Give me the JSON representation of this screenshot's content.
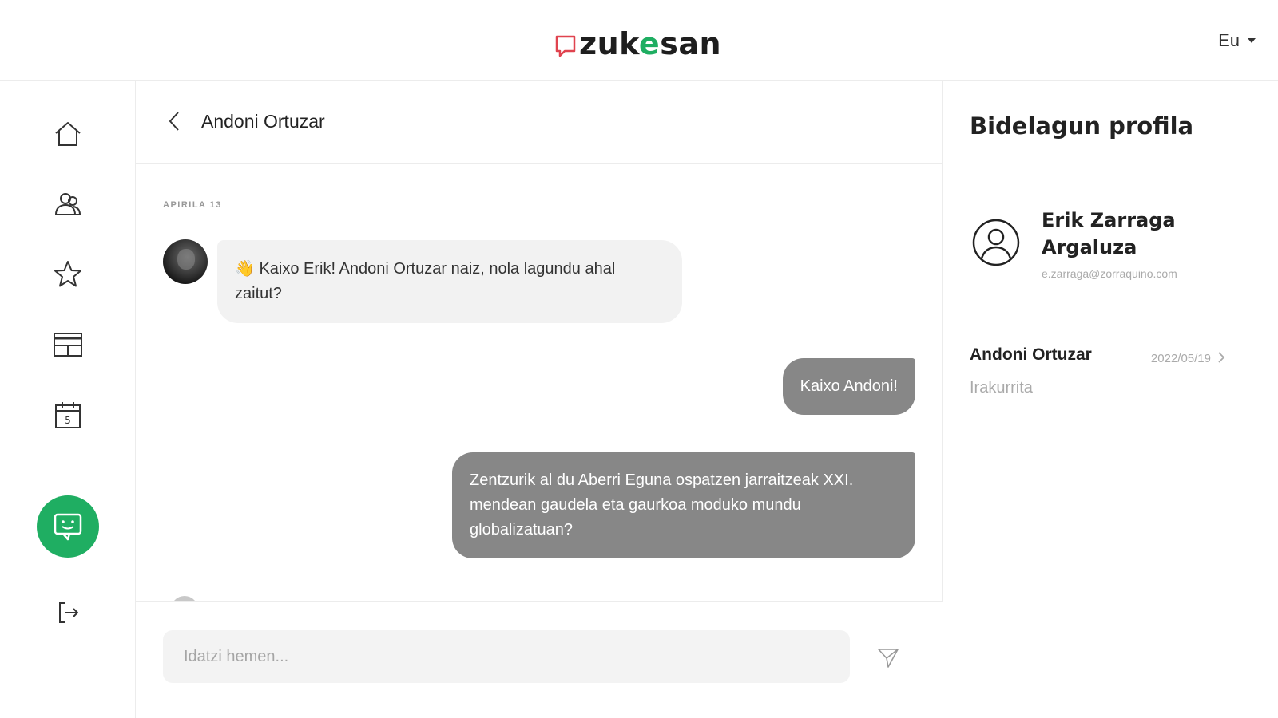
{
  "header": {
    "logo_text_a": "zuk",
    "logo_text_e": "e",
    "logo_text_b": "san",
    "language": "Eu"
  },
  "sidebar": {
    "items": [
      {
        "icon": "home-icon"
      },
      {
        "icon": "users-icon"
      },
      {
        "icon": "star-icon"
      },
      {
        "icon": "board-icon"
      },
      {
        "icon": "calendar-icon"
      },
      {
        "icon": "chat-icon",
        "active": true
      },
      {
        "icon": "logout-icon"
      }
    ]
  },
  "chat": {
    "title": "Andoni Ortuzar",
    "date_separator": "APIRILA 13",
    "messages": [
      {
        "direction": "in",
        "text": "👋 Kaixo Erik! Andoni Ortuzar naiz, nola lagundu ahal zaitut?"
      },
      {
        "direction": "out",
        "text": "Kaixo Andoni!"
      },
      {
        "direction": "out",
        "text": "Zentzurik al du Aberri Eguna ospatzen jarraitzeak XXI. mendean gaudela eta gaurkoa moduko mundu globalizatuan?"
      }
    ],
    "input_placeholder": "Idatzi hemen..."
  },
  "profile": {
    "title": "Bidelagun profila",
    "name": "Erik Zarraga Argaluza",
    "email": "e.zarraga@zorraquino.com",
    "conversation": {
      "name": "Andoni Ortuzar",
      "date": "2022/05/19",
      "status": "Irakurrita"
    }
  },
  "colors": {
    "accent": "#1fae62",
    "brand_mark": "#e0434f",
    "outgoing_bubble": "#878787",
    "incoming_bubble": "#f2f2f2"
  }
}
